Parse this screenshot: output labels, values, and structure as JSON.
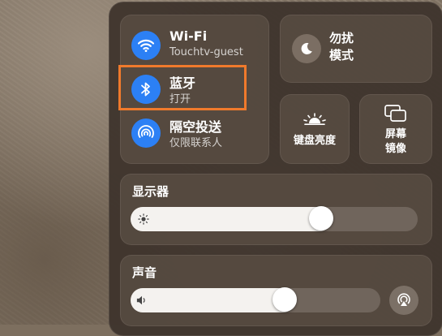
{
  "network": {
    "wifi": {
      "title": "Wi-Fi",
      "subtitle": "Touchtv-guest",
      "icon": "wifi-icon"
    },
    "bluetooth": {
      "title": "蓝牙",
      "subtitle": "打开",
      "icon": "bluetooth-icon",
      "highlighted": true
    },
    "airdrop": {
      "title": "隔空投送",
      "subtitle": "仅限联系人",
      "icon": "airdrop-icon"
    }
  },
  "focus": {
    "label": "勿扰\n模式",
    "icon": "moon-icon"
  },
  "keyboard_brightness": {
    "label": "键盘亮度",
    "icon": "keyboard-brightness-icon"
  },
  "screen_mirroring": {
    "label": "屏幕\n镜像",
    "icon": "screen-mirroring-icon"
  },
  "display": {
    "title": "显示器",
    "level": 0.72,
    "icon": "sun-icon"
  },
  "sound": {
    "title": "声音",
    "level": 0.6,
    "icon": "speaker-icon",
    "output_icon": "airplay-audio-icon"
  },
  "colors": {
    "accent": "#2c80f5",
    "highlight": "#f07a2c"
  }
}
